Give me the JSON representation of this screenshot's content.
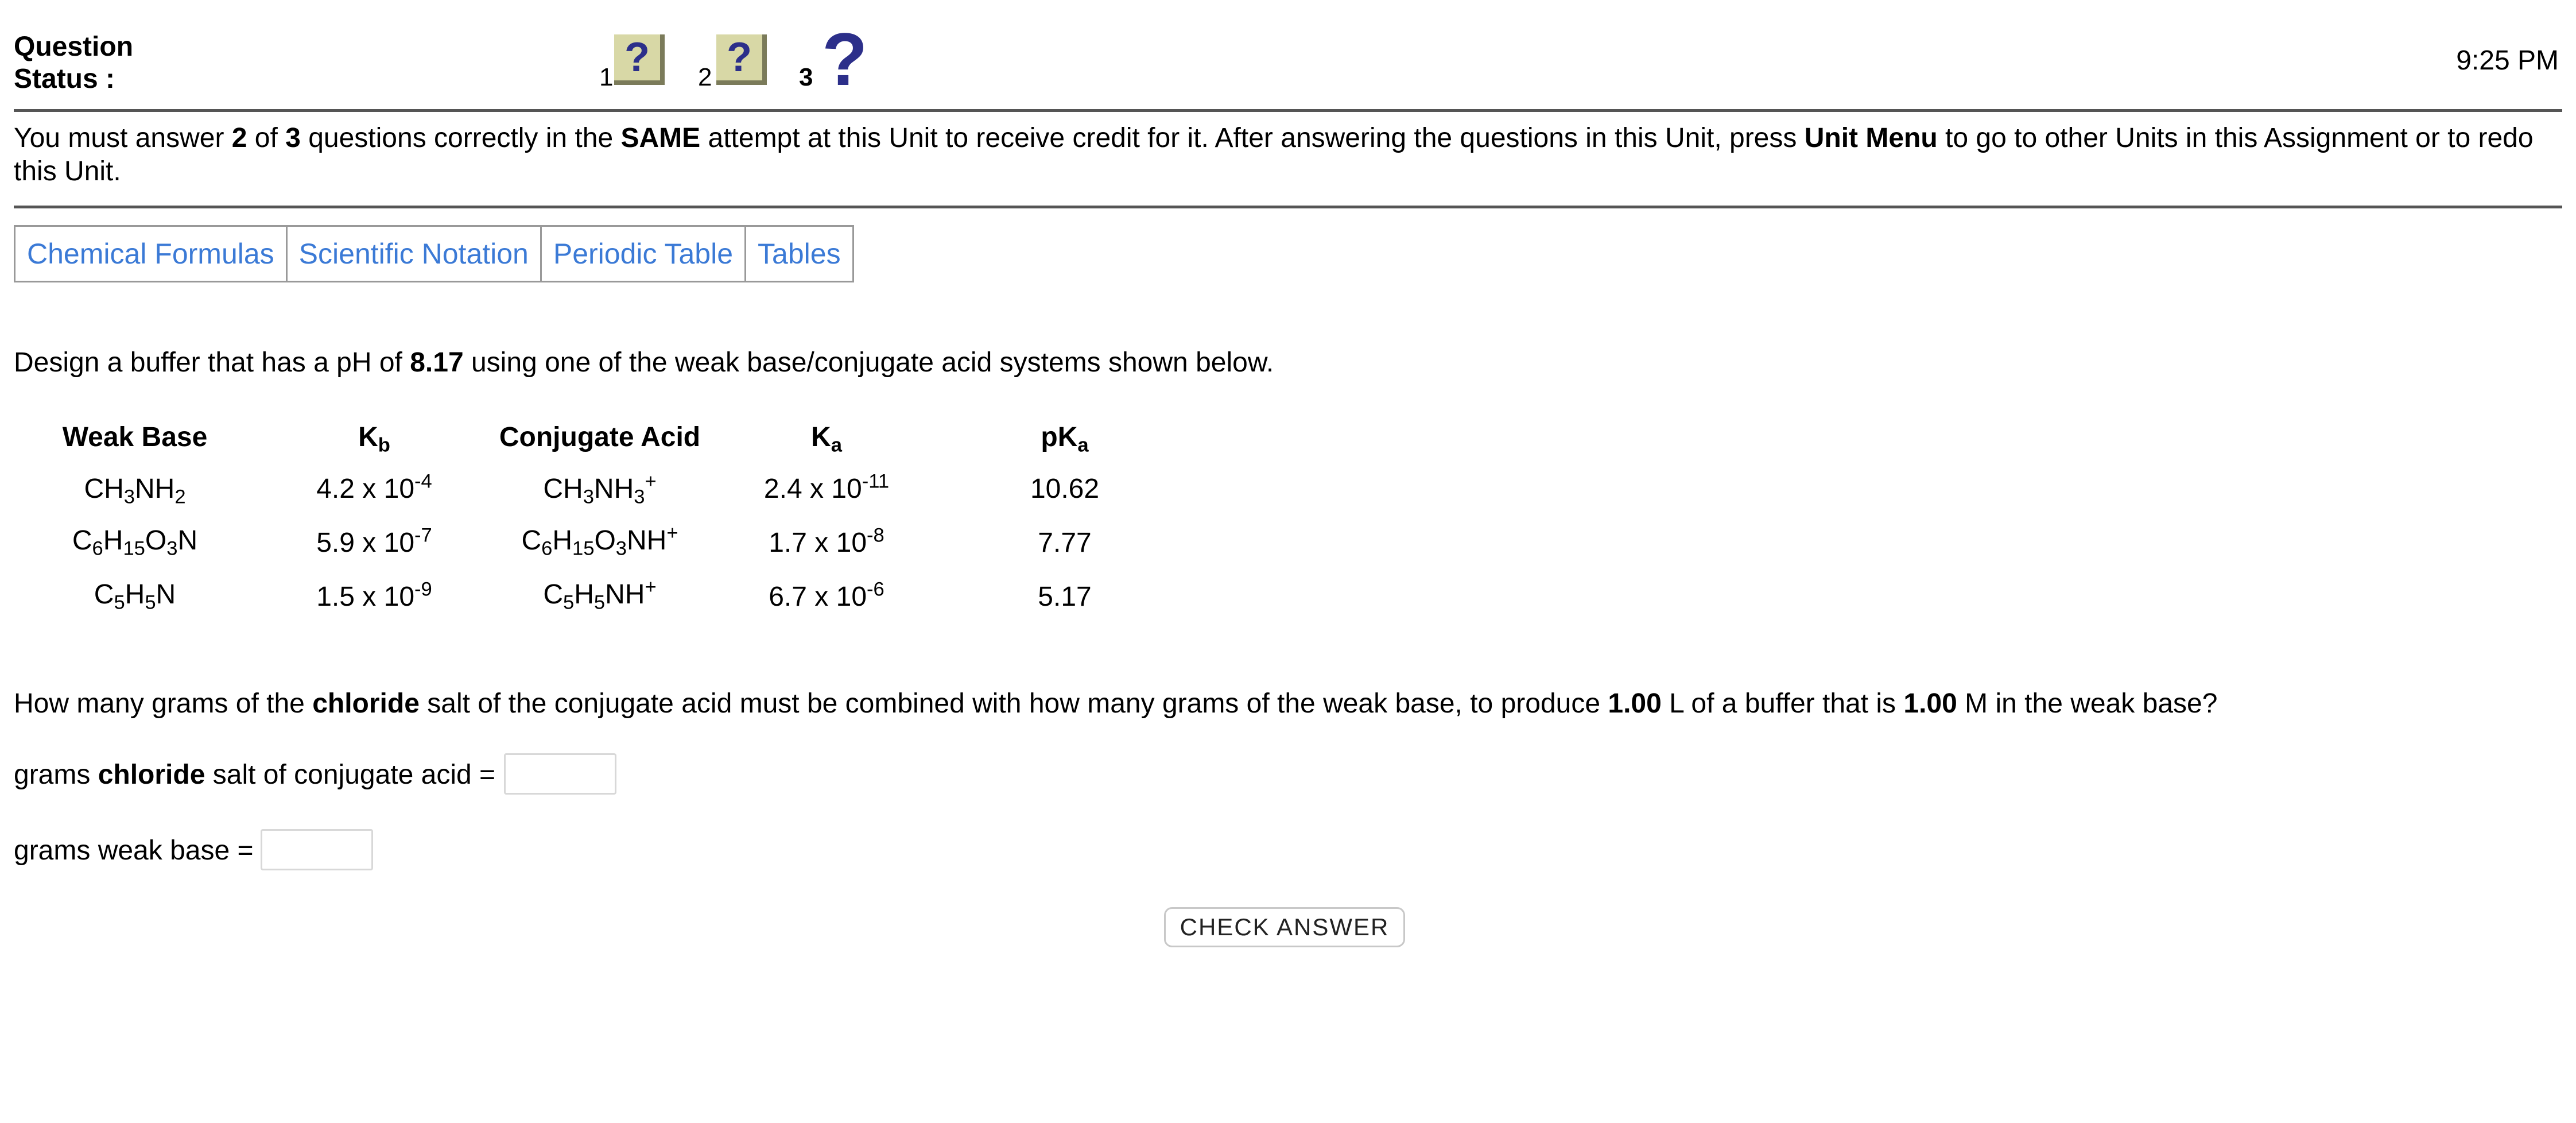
{
  "header": {
    "status_label_1": "Question",
    "status_label_2": "Status :",
    "time": "9:25 PM",
    "questions": [
      {
        "number": "1",
        "mark": "?"
      },
      {
        "number": "2",
        "mark": "?"
      },
      {
        "number": "3",
        "mark": "?"
      }
    ]
  },
  "instructions": {
    "t1": "You must answer ",
    "b1": "2",
    "t2": " of ",
    "b2": "3",
    "t3": " questions correctly in the ",
    "b3": "SAME",
    "t4": " attempt at this Unit to receive credit for it. After answering the questions in this Unit, press ",
    "b4": "Unit Menu",
    "t5": " to go to other Units in this Assignment or to redo this Unit."
  },
  "tabs": [
    "Chemical Formulas",
    "Scientific Notation",
    "Periodic Table",
    "Tables"
  ],
  "problem": {
    "design_prefix": "Design a buffer that has a pH of ",
    "ph": "8.17",
    "design_suffix": " using one of the weak base/conjugate acid systems shown below.",
    "howmany_1": "How many grams of the ",
    "howmany_b1": "chloride",
    "howmany_2": " salt of the conjugate acid must be combined with how many grams of the weak base, to produce ",
    "howmany_b2": "1.00",
    "howmany_3": " L of a buffer that is ",
    "howmany_b3": "1.00",
    "howmany_4": " M in the weak base?"
  },
  "table": {
    "headers": {
      "weak_base": "Weak Base",
      "kb": "K",
      "kb_sub": "b",
      "acid": "Conjugate Acid",
      "ka": "K",
      "ka_sub": "a",
      "pka": "pK",
      "pka_sub": "a"
    },
    "rows": [
      {
        "base": [
          "CH",
          "3",
          "NH",
          "2"
        ],
        "kb": [
          "4.2 x 10",
          "-4"
        ],
        "acid": [
          "CH",
          "3",
          "NH",
          "3",
          "+"
        ],
        "ka": [
          "2.4 x 10",
          "-11"
        ],
        "pka": "10.62"
      },
      {
        "base": [
          "C",
          "6",
          "H",
          "15",
          "O",
          "3",
          "N"
        ],
        "kb": [
          "5.9 x 10",
          "-7"
        ],
        "acid": [
          "C",
          "6",
          "H",
          "15",
          "O",
          "3",
          "NH",
          "+"
        ],
        "ka": [
          "1.7 x 10",
          "-8"
        ],
        "pka": "7.77"
      },
      {
        "base": [
          "C",
          "5",
          "H",
          "5",
          "N"
        ],
        "kb": [
          "1.5 x 10",
          "-9"
        ],
        "acid": [
          "C",
          "5",
          "H",
          "5",
          "NH",
          "+"
        ],
        "ka": [
          "6.7 x 10",
          "-6"
        ],
        "pka": "5.17"
      }
    ]
  },
  "answers": {
    "salt_1": "grams ",
    "salt_b": "chloride",
    "salt_2": " salt of conjugate acid =",
    "salt_value": "",
    "base_label": "grams weak base =",
    "base_value": ""
  },
  "check_button": "CHECK ANSWER",
  "colors": {
    "link": "#3b7ad6",
    "question_mark": "#2c2f8a",
    "question_box": "#d8d8a6"
  }
}
